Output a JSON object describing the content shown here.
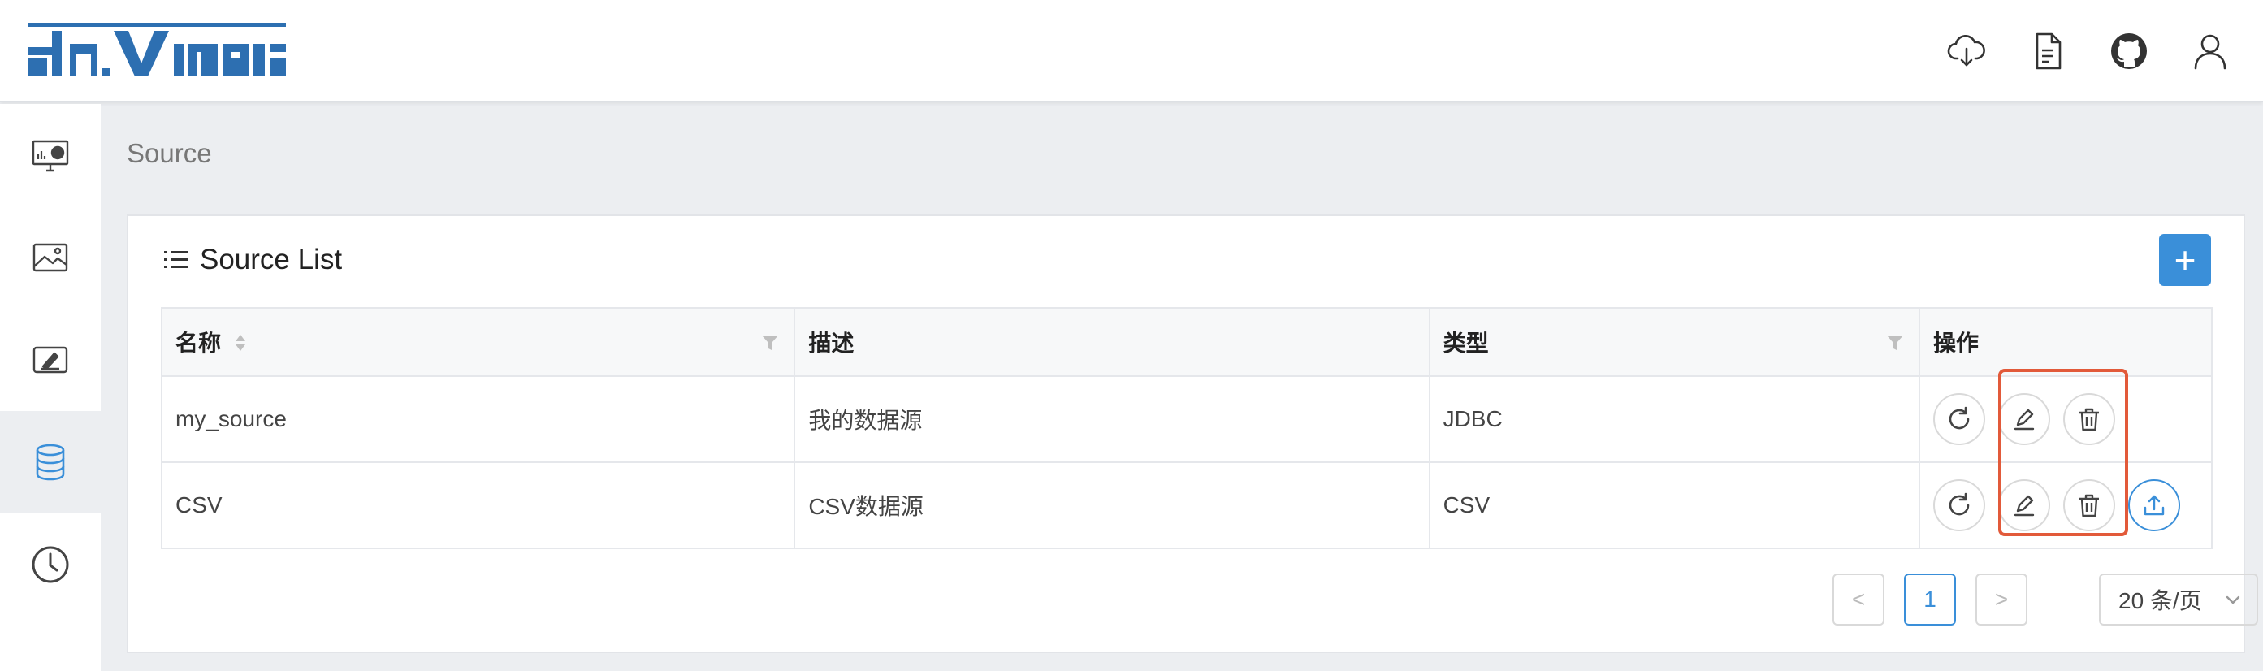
{
  "header": {
    "logo_text": "davinci",
    "icons": [
      "cloud-download-icon",
      "document-icon",
      "github-icon",
      "user-icon"
    ]
  },
  "sidebar": {
    "items": [
      {
        "name": "dashboard",
        "icon": "dashboard-monitor-icon",
        "active": false
      },
      {
        "name": "widgets",
        "icon": "widget-image-icon",
        "active": false
      },
      {
        "name": "views",
        "icon": "view-edit-icon",
        "active": false
      },
      {
        "name": "sources",
        "icon": "database-icon",
        "active": true
      },
      {
        "name": "schedules",
        "icon": "clock-icon",
        "active": false
      }
    ]
  },
  "page": {
    "title": "Source"
  },
  "card": {
    "title": "Source List",
    "add_label": "+"
  },
  "table": {
    "columns": [
      "名称",
      "描述",
      "类型",
      "操作"
    ],
    "rows": [
      {
        "name": "my_source",
        "description": "我的数据源",
        "type": "JDBC",
        "has_upload": false
      },
      {
        "name": "CSV",
        "description": "CSV数据源",
        "type": "CSV",
        "has_upload": true
      }
    ]
  },
  "pagination": {
    "prev": "<",
    "current": "1",
    "next": ">",
    "page_size": "20 条/页"
  },
  "colors": {
    "accent": "#3a8fd9",
    "highlight": "#e25a3a",
    "logo": "#2d6fb1"
  }
}
